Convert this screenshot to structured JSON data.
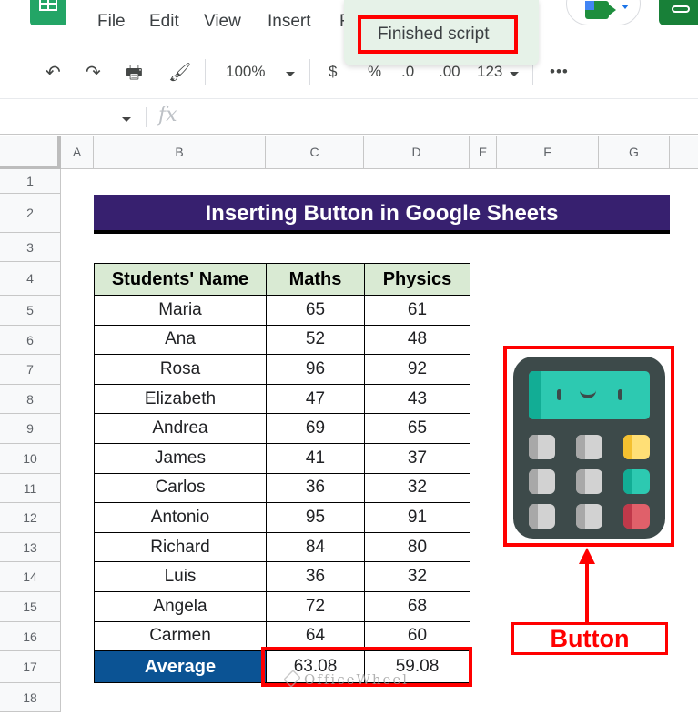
{
  "menubar": {
    "items": [
      "File",
      "Edit",
      "View",
      "Insert",
      "F"
    ]
  },
  "toolbar": {
    "zoom": "100%",
    "currency": "$",
    "percent": "%",
    "decrease_decimal": ".0",
    "increase_decimal": ".00",
    "number_format": "123",
    "more": "•••"
  },
  "toast": {
    "message": "Finished script"
  },
  "formula_bar": {
    "fx_label": "fx",
    "value": ""
  },
  "columns": [
    "A",
    "B",
    "C",
    "D",
    "E",
    "F",
    "G"
  ],
  "rows": [
    "1",
    "2",
    "3",
    "4",
    "5",
    "6",
    "7",
    "8",
    "9",
    "10",
    "11",
    "12",
    "13",
    "14",
    "15",
    "16",
    "17",
    "18"
  ],
  "sheet": {
    "title": "Inserting Button in Google Sheets",
    "headers": [
      "Students' Name",
      "Maths",
      "Physics"
    ],
    "students": [
      {
        "name": "Maria",
        "maths": "65",
        "physics": "61"
      },
      {
        "name": "Ana",
        "maths": "52",
        "physics": "48"
      },
      {
        "name": "Rosa",
        "maths": "96",
        "physics": "92"
      },
      {
        "name": "Elizabeth",
        "maths": "47",
        "physics": "43"
      },
      {
        "name": "Andrea",
        "maths": "69",
        "physics": "65"
      },
      {
        "name": "James",
        "maths": "41",
        "physics": "37"
      },
      {
        "name": "Carlos",
        "maths": "36",
        "physics": "32"
      },
      {
        "name": "Antonio",
        "maths": "95",
        "physics": "91"
      },
      {
        "name": "Richard",
        "maths": "84",
        "physics": "80"
      },
      {
        "name": "Luis",
        "maths": "36",
        "physics": "32"
      },
      {
        "name": "Angela",
        "maths": "72",
        "physics": "68"
      },
      {
        "name": "Carmen",
        "maths": "64",
        "physics": "60"
      }
    ],
    "average": {
      "label": "Average",
      "maths": "63.08",
      "physics": "59.08"
    }
  },
  "annotation": {
    "button_label": "Button",
    "highlight_color": "#ff0000"
  },
  "watermark": "OfficeWheel",
  "colors": {
    "title_bg": "#37206f",
    "header_bg": "#d9ead3",
    "average_bg": "#0b5394",
    "sheets_green": "#23a566"
  }
}
